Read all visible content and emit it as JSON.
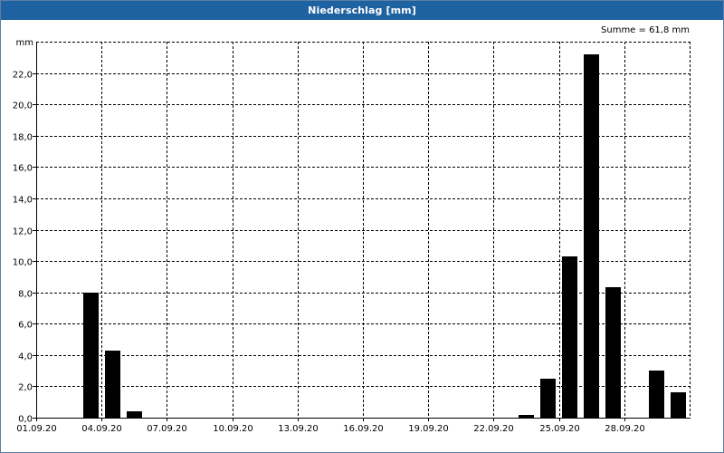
{
  "window": {
    "title": "Niederschlag [mm]"
  },
  "summary": {
    "text": "Summe = 61,8 mm"
  },
  "colors": {
    "titlebar": "#1f62a1",
    "bar": "#000000",
    "grid": "#000000"
  },
  "chart_data": {
    "type": "bar",
    "title": "Niederschlag [mm]",
    "xlabel": "",
    "ylabel": "mm",
    "ylim": [
      0,
      24
    ],
    "grid": true,
    "yticks": [
      "0,0",
      "2,0",
      "4,0",
      "6,0",
      "8,0",
      "10,0",
      "12,0",
      "14,0",
      "16,0",
      "18,0",
      "20,0",
      "22,0"
    ],
    "xtick_labels": [
      "01.09.20",
      "04.09.20",
      "07.09.20",
      "10.09.20",
      "13.09.20",
      "16.09.20",
      "19.09.20",
      "22.09.20",
      "25.09.20",
      "28.09.20"
    ],
    "categories": [
      "01.09.20",
      "02.09.20",
      "03.09.20",
      "04.09.20",
      "05.09.20",
      "06.09.20",
      "07.09.20",
      "08.09.20",
      "09.09.20",
      "10.09.20",
      "11.09.20",
      "12.09.20",
      "13.09.20",
      "14.09.20",
      "15.09.20",
      "16.09.20",
      "17.09.20",
      "18.09.20",
      "19.09.20",
      "20.09.20",
      "21.09.20",
      "22.09.20",
      "23.09.20",
      "24.09.20",
      "25.09.20",
      "26.09.20",
      "27.09.20",
      "28.09.20",
      "29.09.20",
      "30.09.20"
    ],
    "values": [
      0,
      0,
      8.0,
      4.3,
      0.4,
      0,
      0,
      0,
      0,
      0,
      0,
      0,
      0,
      0,
      0,
      0,
      0,
      0,
      0,
      0,
      0,
      0,
      0.2,
      2.5,
      10.3,
      23.2,
      8.3,
      0,
      3.0,
      1.6
    ]
  }
}
